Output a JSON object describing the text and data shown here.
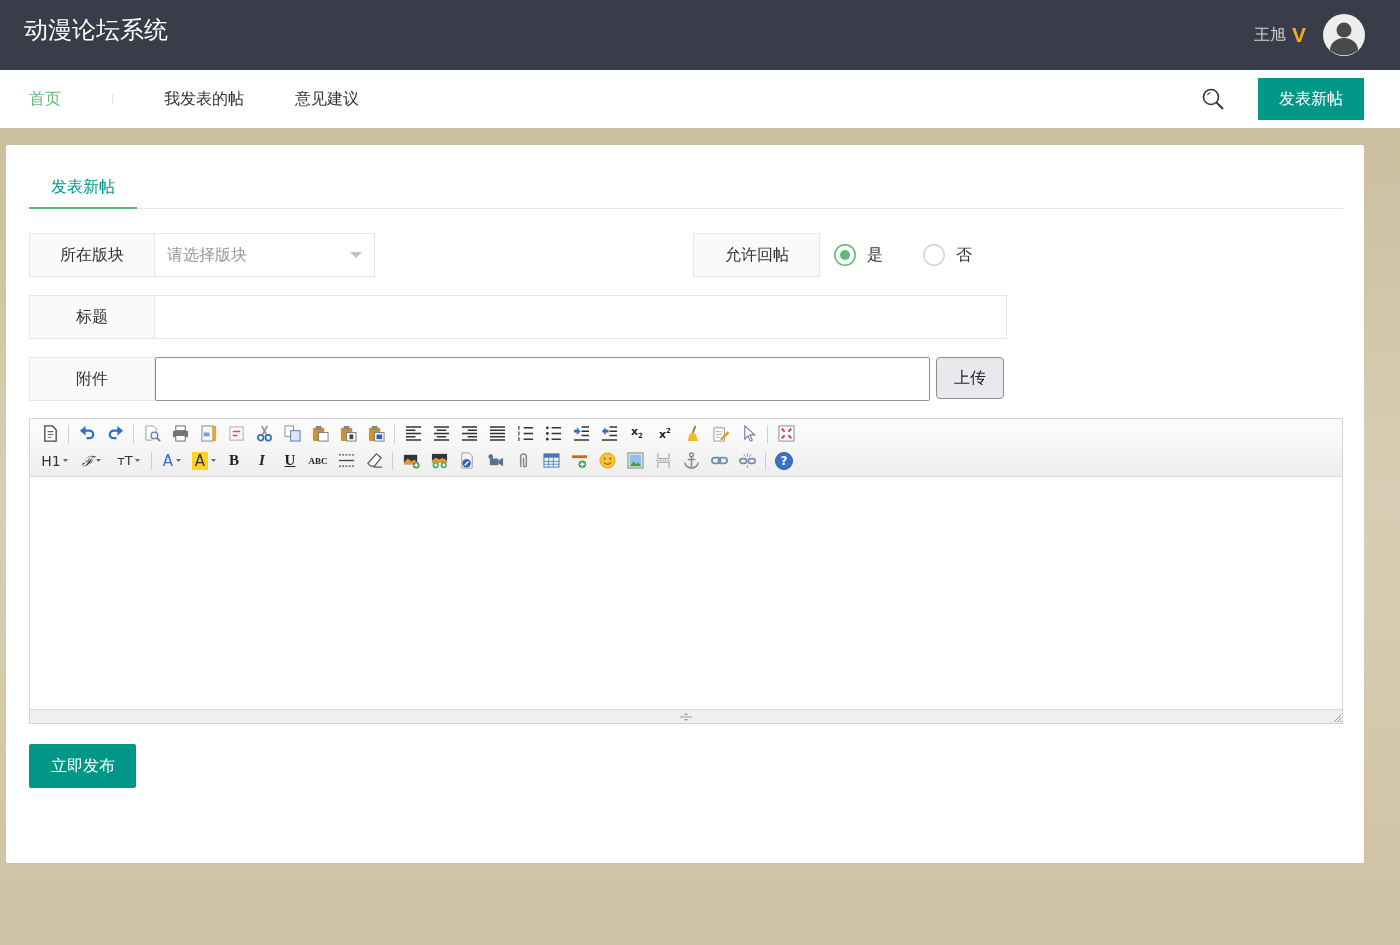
{
  "header": {
    "title": "动漫论坛系统",
    "user": {
      "name": "王旭",
      "badge": "V"
    }
  },
  "nav": {
    "items": [
      {
        "label": "首页",
        "selected": true
      },
      {
        "label": "我发表的帖",
        "selected": false
      },
      {
        "label": "意见建议",
        "selected": false
      }
    ],
    "new_post_button": "发表新帖"
  },
  "tabs": [
    {
      "label": "发表新帖",
      "selected": true
    }
  ],
  "form": {
    "section": {
      "label": "所在版块",
      "placeholder": "请选择版块"
    },
    "allow_reply": {
      "label": "允许回帖",
      "options": [
        {
          "label": "是",
          "selected": true
        },
        {
          "label": "否",
          "selected": false
        }
      ]
    },
    "title": {
      "label": "标题"
    },
    "attachment": {
      "label": "附件",
      "button": "上传"
    }
  },
  "editor": {
    "toolbar": [
      [
        {
          "kind": "source"
        },
        {
          "kind": "separator"
        },
        {
          "kind": "undo"
        },
        {
          "kind": "redo"
        },
        {
          "kind": "separator"
        },
        {
          "kind": "preview"
        },
        {
          "kind": "print"
        },
        {
          "kind": "template"
        },
        {
          "kind": "code"
        },
        {
          "kind": "cut"
        },
        {
          "kind": "copy"
        },
        {
          "kind": "paste"
        },
        {
          "kind": "pastetext"
        },
        {
          "kind": "pasteword"
        },
        {
          "kind": "separator"
        },
        {
          "kind": "alignleft"
        },
        {
          "kind": "aligncenter"
        },
        {
          "kind": "alignright"
        },
        {
          "kind": "alignjustify"
        },
        {
          "kind": "orderedlist"
        },
        {
          "kind": "unorderedlist"
        },
        {
          "kind": "indent"
        },
        {
          "kind": "outdent"
        },
        {
          "kind": "subscript",
          "label": "x$_{2}$"
        },
        {
          "kind": "superscript",
          "label": "x$^{2}$"
        },
        {
          "kind": "formatbrush"
        },
        {
          "kind": "autotypeset"
        },
        {
          "kind": "selectall"
        },
        {
          "kind": "separator"
        },
        {
          "kind": "fullscreen"
        }
      ],
      [
        {
          "kind": "paragraph",
          "label": "H1"
        },
        {
          "kind": "fontfamily",
          "label": "ℱ"
        },
        {
          "kind": "fontsize",
          "label": "ᴛT"
        },
        {
          "kind": "separator"
        },
        {
          "kind": "forecolor",
          "label": "A"
        },
        {
          "kind": "backcolor",
          "label": "A"
        },
        {
          "kind": "bold",
          "label": "B"
        },
        {
          "kind": "italic",
          "label": "I"
        },
        {
          "kind": "underline",
          "label": "U"
        },
        {
          "kind": "strikethrough",
          "label": "ABC"
        },
        {
          "kind": "dashedlines"
        },
        {
          "kind": "eraser"
        },
        {
          "kind": "separator"
        },
        {
          "kind": "image"
        },
        {
          "kind": "multiimage"
        },
        {
          "kind": "flash"
        },
        {
          "kind": "video"
        },
        {
          "kind": "attachment"
        },
        {
          "kind": "table"
        },
        {
          "kind": "horizontalrule"
        },
        {
          "kind": "emotion"
        },
        {
          "kind": "picture"
        },
        {
          "kind": "pagebreak"
        },
        {
          "kind": "anchor"
        },
        {
          "kind": "link"
        },
        {
          "kind": "unlink"
        },
        {
          "kind": "separator"
        },
        {
          "kind": "help",
          "label": "?"
        }
      ]
    ]
  },
  "submit_button": "立即发布"
}
